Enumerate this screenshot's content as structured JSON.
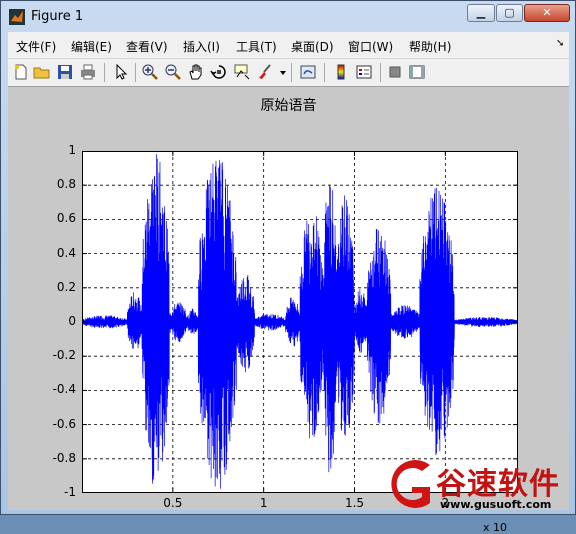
{
  "window": {
    "title": "Figure 1",
    "buttons": {
      "minimize": "▁",
      "maximize": "▢",
      "close": "✕"
    }
  },
  "menubar": {
    "items": [
      "文件(F)",
      "编辑(E)",
      "查看(V)",
      "插入(I)",
      "工具(T)",
      "桌面(D)",
      "窗口(W)",
      "帮助(H)"
    ],
    "overflow_icon": "dock-arrow-icon"
  },
  "toolbar": {
    "icons": [
      "new-figure-icon",
      "open-file-icon",
      "save-icon",
      "print-icon",
      "edit-plot-icon",
      "zoom-in-icon",
      "zoom-out-icon",
      "pan-icon",
      "rotate-3d-icon",
      "data-cursor-icon",
      "brush-icon",
      "brush-dropdown-icon",
      "link-plot-icon",
      "colorbar-icon",
      "legend-icon",
      "hide-plot-tools-icon",
      "show-plot-tools-icon"
    ]
  },
  "chart_data": {
    "type": "line",
    "title": "原始语音",
    "xlabel": "",
    "ylabel": "",
    "x_exponent_label": "x 10",
    "xlim": [
      0,
      2.4
    ],
    "ylim": [
      -1,
      1
    ],
    "x_ticks": [
      "0.5",
      "1",
      "1.5",
      "2"
    ],
    "x_tick_values": [
      0.5,
      1,
      1.5,
      2
    ],
    "y_ticks": [
      "1",
      "0.8",
      "0.6",
      "0.4",
      "0.2",
      "0",
      "-0.2",
      "-0.4",
      "-0.6",
      "-0.8",
      "-1"
    ],
    "y_tick_values": [
      1,
      0.8,
      0.6,
      0.4,
      0.2,
      0,
      -0.2,
      -0.4,
      -0.6,
      -0.8,
      -1
    ],
    "grid": true,
    "line_color": "#0000ff",
    "series": [
      {
        "segments": [
          {
            "x_start": 0.0,
            "x_end": 0.25,
            "peak": 0.04
          },
          {
            "x_start": 0.25,
            "x_end": 0.33,
            "peak": 0.18
          },
          {
            "x_start": 0.33,
            "x_end": 0.48,
            "peak": 1.0
          },
          {
            "x_start": 0.48,
            "x_end": 0.58,
            "peak": 0.12
          },
          {
            "x_start": 0.58,
            "x_end": 0.64,
            "peak": 0.08
          },
          {
            "x_start": 0.64,
            "x_end": 0.85,
            "peak": 1.0
          },
          {
            "x_start": 0.85,
            "x_end": 0.95,
            "peak": 0.3
          },
          {
            "x_start": 0.95,
            "x_end": 1.12,
            "peak": 0.05
          },
          {
            "x_start": 1.12,
            "x_end": 1.2,
            "peak": 0.15
          },
          {
            "x_start": 1.2,
            "x_end": 1.33,
            "peak": 0.7
          },
          {
            "x_start": 1.33,
            "x_end": 1.4,
            "peak": 0.95
          },
          {
            "x_start": 1.4,
            "x_end": 1.5,
            "peak": 0.75
          },
          {
            "x_start": 1.5,
            "x_end": 1.57,
            "peak": 0.2
          },
          {
            "x_start": 1.57,
            "x_end": 1.7,
            "peak": 0.6
          },
          {
            "x_start": 1.7,
            "x_end": 1.86,
            "peak": 0.1
          },
          {
            "x_start": 1.86,
            "x_end": 2.05,
            "peak": 0.8
          },
          {
            "x_start": 2.05,
            "x_end": 2.4,
            "peak": 0.03
          }
        ]
      }
    ]
  },
  "watermark": {
    "brand": "谷速软件",
    "url": "www.gusuoft.com",
    "brand_color": "#c41212"
  }
}
